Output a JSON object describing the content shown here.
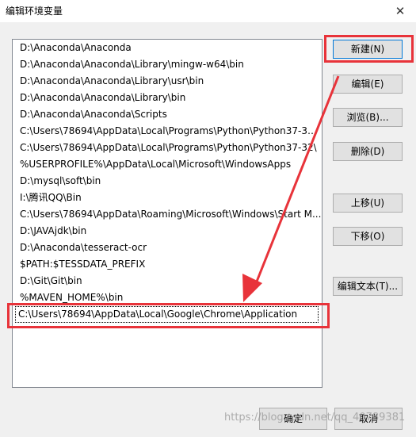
{
  "window": {
    "title": "编辑环境变量",
    "close_glyph": "✕"
  },
  "path_list": {
    "items": [
      "D:\\Anaconda\\Anaconda",
      "D:\\Anaconda\\Anaconda\\Library\\mingw-w64\\bin",
      "D:\\Anaconda\\Anaconda\\Library\\usr\\bin",
      "D:\\Anaconda\\Anaconda\\Library\\bin",
      "D:\\Anaconda\\Anaconda\\Scripts",
      "C:\\Users\\78694\\AppData\\Local\\Programs\\Python\\Python37-32\\...",
      "C:\\Users\\78694\\AppData\\Local\\Programs\\Python\\Python37-32\\",
      "%USERPROFILE%\\AppData\\Local\\Microsoft\\WindowsApps",
      "D:\\mysql\\soft\\bin",
      "I:\\腾讯QQ\\Bin",
      "C:\\Users\\78694\\AppData\\Roaming\\Microsoft\\Windows\\Start M...",
      "D:\\JAVAjdk\\bin",
      "D:\\Anaconda\\tesseract-ocr",
      "$PATH:$TESSDATA_PREFIX",
      "D:\\Git\\Git\\bin",
      "%MAVEN_HOME%\\bin",
      "C:\\Users\\78694\\AppData\\Local\\Google\\Chrome\\Application"
    ],
    "selected_index": 16
  },
  "buttons": {
    "new": "新建(N)",
    "edit": "编辑(E)",
    "browse": "浏览(B)...",
    "delete": "删除(D)",
    "move_up": "上移(U)",
    "move_down": "下移(O)",
    "edit_text": "编辑文本(T)..."
  },
  "footer": {
    "ok": "确定",
    "cancel": "取消"
  },
  "watermark": "https://blog.csdn.net/qq_40789381",
  "annotation_color": "#e8333a"
}
